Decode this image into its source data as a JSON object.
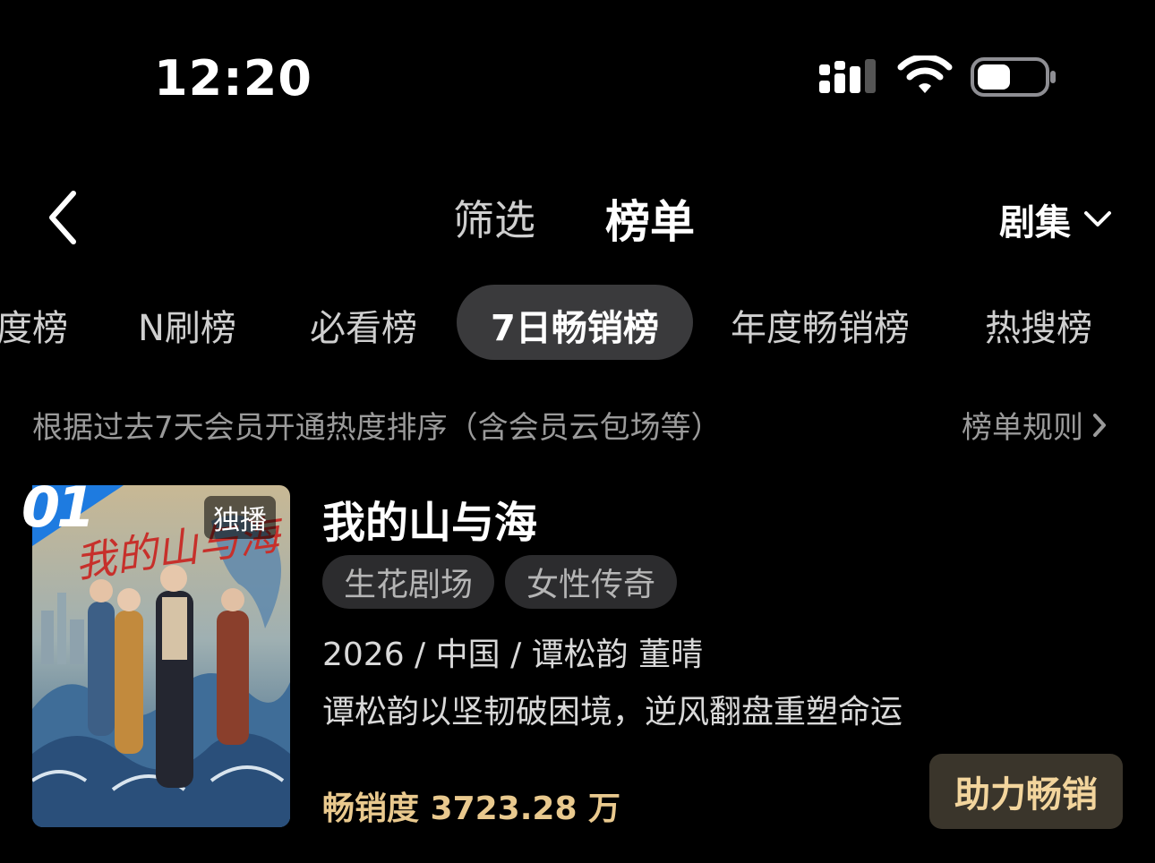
{
  "status_bar": {
    "time": "12:20"
  },
  "header": {
    "tabs": [
      {
        "label": "筛选",
        "active": false
      },
      {
        "label": "榜单",
        "active": true
      }
    ],
    "category_select": "剧集"
  },
  "ranking_tabs": [
    {
      "label": "度榜",
      "active": false
    },
    {
      "label": "N刷榜",
      "active": false
    },
    {
      "label": "必看榜",
      "active": false
    },
    {
      "label": "7日畅销榜",
      "active": true
    },
    {
      "label": "年度畅销榜",
      "active": false
    },
    {
      "label": "热搜榜",
      "active": false
    }
  ],
  "description": {
    "text": "根据过去7天会员开通热度排序（含会员云包场等）",
    "rules_link": "榜单规则"
  },
  "items": [
    {
      "rank": "01",
      "badge": "独播",
      "poster_calligraphy": "我的山与海",
      "title": "我的山与海",
      "tags": [
        "生花剧场",
        "女性传奇"
      ],
      "meta": "2026 / 中国 / 谭松韵 董晴",
      "synopsis": "谭松韵以坚韧破困境，逆风翻盘重塑命运",
      "sales": "畅销度 3723.28 万",
      "boost_button": "助力畅销"
    }
  ],
  "colors": {
    "background": "#000000",
    "active_pill": "#3a3a3c",
    "tag_bg": "#2c2c2e",
    "sales_gold": "#e9c98e",
    "boost_bg": "#3a352b",
    "boost_text": "#f3d59d",
    "rank_blue": "#1e7be0"
  }
}
